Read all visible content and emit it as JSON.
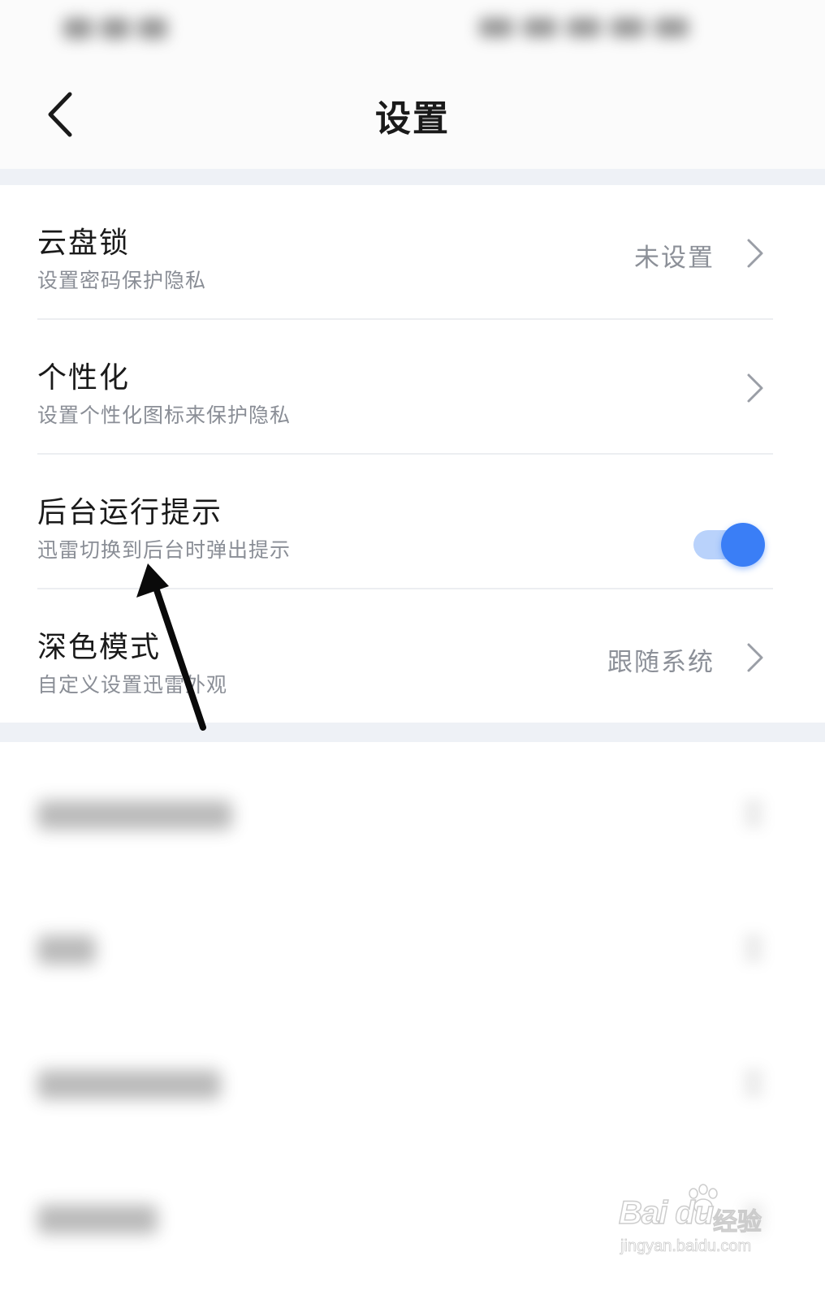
{
  "header": {
    "title": "设置",
    "back_icon": "chevron-left-icon"
  },
  "settings": [
    {
      "title": "云盘锁",
      "subtitle": "设置密码保护隐私",
      "value": "未设置",
      "control": "chevron-right-icon"
    },
    {
      "title": "个性化",
      "subtitle": "设置个性化图标来保护隐私",
      "value": "",
      "control": "chevron-right-icon"
    },
    {
      "title": "后台运行提示",
      "subtitle": "迅雷切换到后台时弹出提示",
      "control": "toggle",
      "toggle_on": true
    },
    {
      "title": "深色模式",
      "subtitle": "自定义设置迅雷外观",
      "value": "跟随系统",
      "control": "chevron-right-icon"
    }
  ],
  "colors": {
    "accent": "#3a7ef6",
    "toggle_track": "#b9d2fb",
    "section_gap": "#eef1f6",
    "subtitle_text": "#8a8e96"
  },
  "watermark": {
    "brand": "Bai du",
    "cn": "经验",
    "url": "jingyan.baidu.com"
  }
}
